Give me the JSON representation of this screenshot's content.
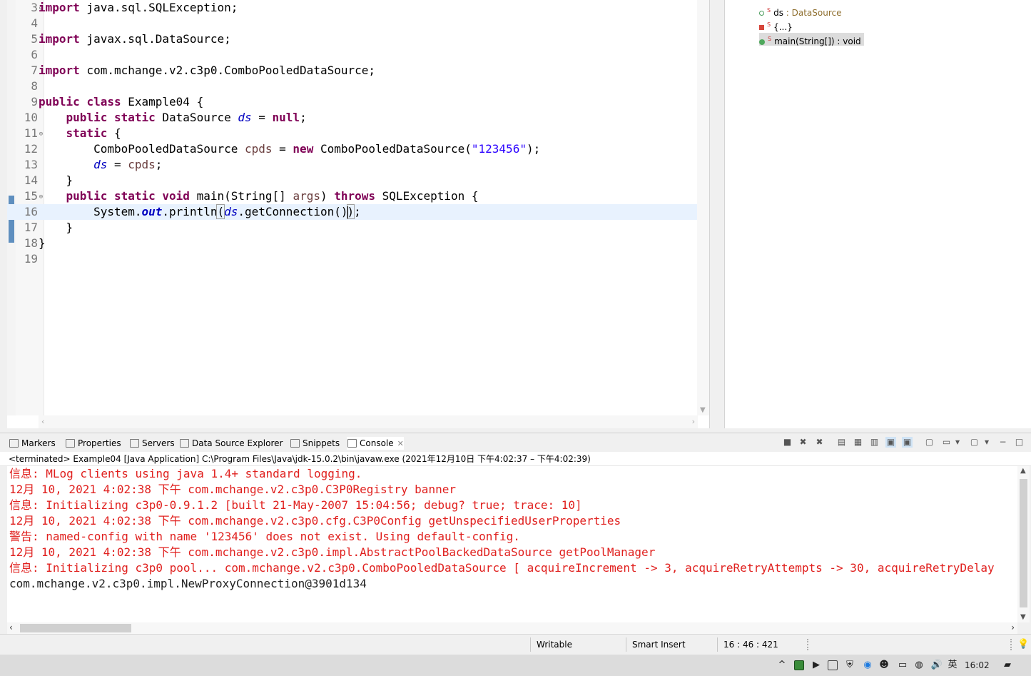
{
  "editor": {
    "lines": [
      {
        "n": "3",
        "fold": "⊖",
        "seg": [
          {
            "t": "import",
            "c": "kw"
          },
          {
            "t": " java.sql.SQLException;"
          }
        ]
      },
      {
        "n": "4",
        "seg": []
      },
      {
        "n": "5",
        "seg": [
          {
            "t": "import",
            "c": "kw"
          },
          {
            "t": " javax.sql.DataSource;"
          }
        ]
      },
      {
        "n": "6",
        "seg": []
      },
      {
        "n": "7",
        "seg": [
          {
            "t": "import",
            "c": "kw"
          },
          {
            "t": " com.mchange.v2.c3p0.ComboPooledDataSource;"
          }
        ]
      },
      {
        "n": "8",
        "seg": []
      },
      {
        "n": "9",
        "seg": [
          {
            "t": "public",
            "c": "kw"
          },
          {
            "t": " "
          },
          {
            "t": "class",
            "c": "kw"
          },
          {
            "t": " Example04 {"
          }
        ]
      },
      {
        "n": "10",
        "seg": [
          {
            "t": "    "
          },
          {
            "t": "public",
            "c": "kw"
          },
          {
            "t": " "
          },
          {
            "t": "static",
            "c": "kw"
          },
          {
            "t": " DataSource "
          },
          {
            "t": "ds",
            "c": "fld"
          },
          {
            "t": " = "
          },
          {
            "t": "null",
            "c": "kw"
          },
          {
            "t": ";"
          }
        ]
      },
      {
        "n": "11",
        "fold": "⊖",
        "seg": [
          {
            "t": "    "
          },
          {
            "t": "static",
            "c": "kw"
          },
          {
            "t": " {"
          }
        ]
      },
      {
        "n": "12",
        "seg": [
          {
            "t": "        ComboPooledDataSource "
          },
          {
            "t": "cpds",
            "c": "lvar"
          },
          {
            "t": " = "
          },
          {
            "t": "new",
            "c": "kw"
          },
          {
            "t": " ComboPooledDataSource("
          },
          {
            "t": "\"123456\"",
            "c": "str"
          },
          {
            "t": ");"
          }
        ]
      },
      {
        "n": "13",
        "seg": [
          {
            "t": "        "
          },
          {
            "t": "ds",
            "c": "fld"
          },
          {
            "t": " = "
          },
          {
            "t": "cpds",
            "c": "lvar"
          },
          {
            "t": ";"
          }
        ]
      },
      {
        "n": "14",
        "seg": [
          {
            "t": "    }"
          }
        ]
      },
      {
        "n": "15",
        "fold": "⊖",
        "seg": [
          {
            "t": "    "
          },
          {
            "t": "public",
            "c": "kw"
          },
          {
            "t": " "
          },
          {
            "t": "static",
            "c": "kw"
          },
          {
            "t": " "
          },
          {
            "t": "void",
            "c": "kw"
          },
          {
            "t": " main(String[] "
          },
          {
            "t": "args",
            "c": "lvar"
          },
          {
            "t": ") "
          },
          {
            "t": "throws",
            "c": "kw"
          },
          {
            "t": " SQLException {"
          }
        ]
      },
      {
        "n": "16",
        "current": true,
        "seg": [
          {
            "t": "        System."
          },
          {
            "t": "out",
            "c": "sfld"
          },
          {
            "t": ".println"
          },
          {
            "t": "(",
            "c": "bracket"
          },
          {
            "t": "ds",
            "c": "fld"
          },
          {
            "t": ".getConnection()"
          },
          {
            "caret": true
          },
          {
            "t": ")",
            "c": "bracket"
          },
          {
            "t": ";"
          }
        ]
      },
      {
        "n": "17",
        "seg": [
          {
            "t": "    }"
          }
        ]
      },
      {
        "n": "18",
        "seg": [
          {
            "t": "}"
          }
        ]
      },
      {
        "n": "19",
        "seg": []
      }
    ]
  },
  "outline": {
    "items": [
      {
        "name": "ds",
        "sep": " : ",
        "type": "DataSource",
        "sym": "field",
        "mod": "S"
      },
      {
        "name": "{...}",
        "type": "",
        "sym": "init",
        "mod": "S"
      },
      {
        "name": "main(String[]) : void",
        "type": "",
        "sym": "method",
        "mod": "S",
        "selected": true
      }
    ]
  },
  "console_view": {
    "tabs": [
      {
        "id": "markers",
        "label": "Markers"
      },
      {
        "id": "properties",
        "label": "Properties"
      },
      {
        "id": "servers",
        "label": "Servers"
      },
      {
        "id": "data-source-explorer",
        "label": "Data Source Explorer"
      },
      {
        "id": "snippets",
        "label": "Snippets"
      },
      {
        "id": "console",
        "label": "Console",
        "active": true,
        "close": "✕"
      }
    ],
    "description": "<terminated> Example04 [Java Application] C:\\Program Files\\Java\\jdk-15.0.2\\bin\\javaw.exe  (2021年12月10日 下午4:02:37 – 下午4:02:39)",
    "output": [
      {
        "text": "信息: MLog clients using java 1.4+ standard logging.",
        "color": "red"
      },
      {
        "text": "12月 10, 2021 4:02:38 下午 com.mchange.v2.c3p0.C3P0Registry banner",
        "color": "red"
      },
      {
        "text": "信息: Initializing c3p0-0.9.1.2 [built 21-May-2007 15:04:56; debug? true; trace: 10]",
        "color": "red"
      },
      {
        "text": "12月 10, 2021 4:02:38 下午 com.mchange.v2.c3p0.cfg.C3P0Config getUnspecifiedUserProperties",
        "color": "red"
      },
      {
        "text": "警告: named-config with name '123456' does not exist. Using default-config.",
        "color": "red"
      },
      {
        "text": "12月 10, 2021 4:02:38 下午 com.mchange.v2.c3p0.impl.AbstractPoolBackedDataSource getPoolManager",
        "color": "red"
      },
      {
        "text": "信息: Initializing c3p0 pool... com.mchange.v2.c3p0.ComboPooledDataSource [ acquireIncrement -> 3, acquireRetryAttempts -> 30, acquireRetryDelay",
        "color": "red"
      },
      {
        "text": "com.mchange.v2.c3p0.impl.NewProxyConnection@3901d134",
        "color": "black"
      }
    ]
  },
  "status": {
    "writable": "Writable",
    "insert_mode": "Smart Insert",
    "position": "16 : 46 : 421"
  },
  "taskbar": {
    "ime": "英",
    "volume": "🔊",
    "clock": "16:02"
  },
  "colors": {
    "keyword": "#7f0055",
    "field": "#0000c0",
    "string": "#2a00ff",
    "console_error": "#e0201e",
    "current_line": "#e8f2fe"
  }
}
